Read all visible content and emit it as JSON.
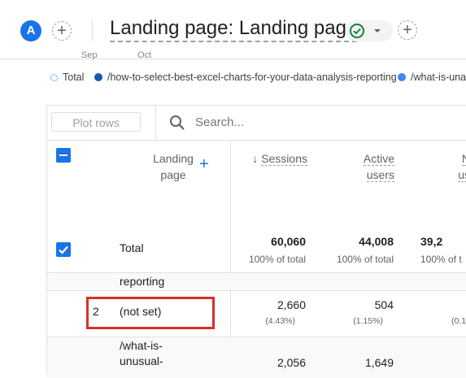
{
  "header": {
    "avatar_letter": "A",
    "add_comparison_symbol": "+",
    "title": "Landing page: Landing page",
    "add_card_symbol": "+"
  },
  "chart_axis": {
    "month_1": "Sep",
    "month_2": "Oct"
  },
  "legend": {
    "items": [
      {
        "label": "Total"
      },
      {
        "label": "/how-to-select-best-excel-charts-for-your-data-analysis-reporting"
      },
      {
        "label": "/what-is-una"
      }
    ]
  },
  "toolbar": {
    "plot_rows_label": "Plot rows",
    "search_placeholder": "Search..."
  },
  "table": {
    "columns": {
      "dimension_line1": "Landing",
      "dimension_line2": "page",
      "add_dimension_symbol": "+",
      "sessions_label": "Sessions",
      "active_users_line1": "Active",
      "active_users_line2": "users",
      "new_users_line1": "N",
      "new_users_line2": "us"
    },
    "total": {
      "label": "Total",
      "sessions": "60,060",
      "sessions_pct": "100% of total",
      "active_users": "44,008",
      "active_users_pct": "100% of total",
      "new_users": "39,2",
      "new_users_pct": "100% of t"
    },
    "rows": [
      {
        "label": "reporting"
      },
      {
        "index": "2",
        "label": "(not set)",
        "sessions": "2,660",
        "sessions_pct": "(4.43%)",
        "active_users": "504",
        "active_users_pct": "(1.15%)",
        "new_users_pct": "(0.1"
      },
      {
        "label_line1": "/what-is-",
        "label_line2": "unusual-",
        "sessions": "2,056",
        "active_users": "1,649"
      }
    ]
  },
  "colors": {
    "accent": "#1a73e8",
    "highlight": "#d93025",
    "status_ok": "#188038"
  }
}
